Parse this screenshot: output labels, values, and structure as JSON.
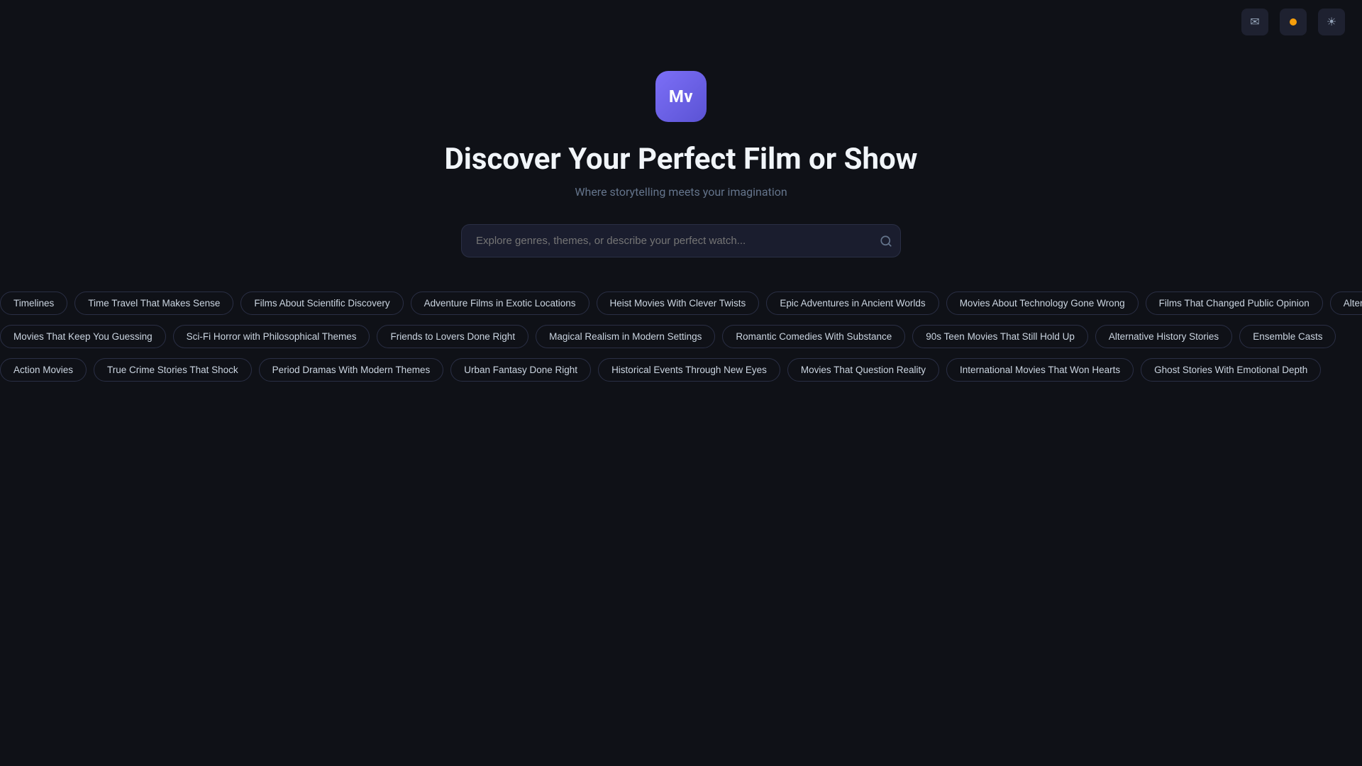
{
  "header": {
    "email_icon": "✉",
    "user_icon": "●",
    "theme_icon": "☀"
  },
  "logo": {
    "text": "Mv"
  },
  "hero": {
    "title": "Discover Your Perfect Film or Show",
    "subtitle": "Where storytelling meets your imagination"
  },
  "search": {
    "placeholder": "Explore genres, themes, or describe your perfect watch..."
  },
  "tag_rows": [
    [
      "Timelines",
      "Time Travel That Makes Sense",
      "Films About Scientific Discovery",
      "Adventure Films in Exotic Locations",
      "Heist Movies With Clever Twists",
      "Epic Adventures in Ancient Worlds",
      "Movies About Technology Gone Wrong",
      "Films That Changed Public Opinion",
      "Alternative History Stories"
    ],
    [
      "Movies That Keep You Guessing",
      "Sci-Fi Horror with Philosophical Themes",
      "Friends to Lovers Done Right",
      "Magical Realism in Modern Settings",
      "Romantic Comedies With Substance",
      "90s Teen Movies That Still Hold Up",
      "Alternative History Stories",
      "Ensemble Casts"
    ],
    [
      "Action Movies",
      "True Crime Stories That Shock",
      "Period Dramas With Modern Themes",
      "Urban Fantasy Done Right",
      "Historical Events Through New Eyes",
      "Movies That Question Reality",
      "International Movies That Won Hearts",
      "Ghost Stories With Emotional Depth"
    ]
  ]
}
